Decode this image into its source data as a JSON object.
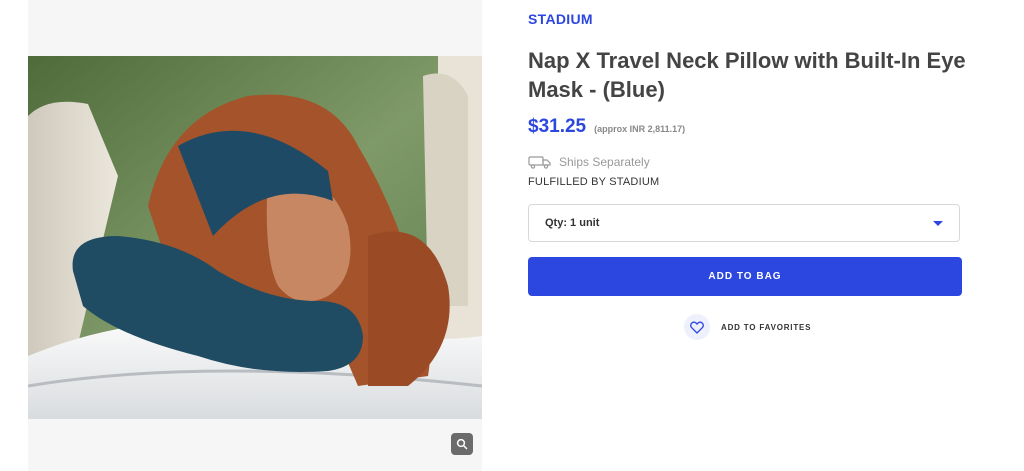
{
  "product": {
    "brand": "STADIUM",
    "title": "Nap X Travel Neck Pillow with Built-In Eye Mask - (Blue)",
    "price": "$31.25",
    "approx_price": "(approx INR 2,811.17)",
    "shipping": "Ships Separately",
    "fulfilled_by": "FULFILLED BY STADIUM"
  },
  "quantity": {
    "selected": "Qty: 1 unit"
  },
  "actions": {
    "add_to_bag": "ADD TO BAG",
    "add_to_favorites": "ADD TO FAVORITES"
  },
  "colors": {
    "accent": "#2c46e0",
    "pillow": "#1f4b63",
    "hair": "#a4532a"
  },
  "icons": {
    "zoom": "search-icon",
    "shipping": "truck-icon",
    "favorite": "heart-icon",
    "qty": "caret-down-icon"
  }
}
